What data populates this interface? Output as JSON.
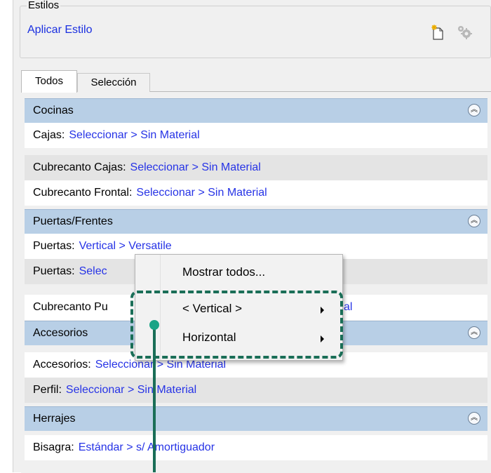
{
  "styles_group": {
    "title": "Estilos",
    "apply_link": "Aplicar Estilo"
  },
  "tabs": [
    {
      "label": "Todos"
    },
    {
      "label": "Selección"
    }
  ],
  "sections": {
    "cocinas": {
      "title": "Cocinas",
      "rows": [
        {
          "label": "Cajas:",
          "value": "Seleccionar > Sin Material"
        },
        {
          "label": "Cubrecanto Cajas:",
          "value": "Seleccionar > Sin Material"
        },
        {
          "label": "Cubrecanto Frontal:",
          "value": "Seleccionar > Sin Material"
        }
      ]
    },
    "puertas": {
      "title": "Puertas/Frentes",
      "rows": [
        {
          "label": "Puertas:",
          "value": "Vertical > Versatile"
        },
        {
          "label": "Puertas:",
          "value": "Selec"
        },
        {
          "label": "Cubrecanto Pu",
          "value": "al"
        }
      ]
    },
    "accesorios": {
      "title": "Accesorios",
      "rows": [
        {
          "label": "Accesorios:",
          "value": "Seleccionar > Sin Material"
        },
        {
          "label": "Perfil:",
          "value": "Seleccionar > Sin Material"
        }
      ]
    },
    "herrajes": {
      "title": "Herrajes",
      "rows": [
        {
          "label": "Bisagra:",
          "value": "Estándar > s/ Amortiguador"
        }
      ]
    }
  },
  "context_menu": {
    "items": [
      {
        "label": "Mostrar todos..."
      },
      {
        "label": "< Vertical >"
      },
      {
        "label": "Horizontal"
      }
    ]
  },
  "icons": {
    "new_style": "new-document-icon",
    "settings": "gear-icon",
    "collapse": "chevron-up-double-icon"
  },
  "colors": {
    "header_bg": "#b8cfe6",
    "link": "#1a2fe0",
    "highlight": "#1a6e57",
    "dot": "#1aa486"
  }
}
